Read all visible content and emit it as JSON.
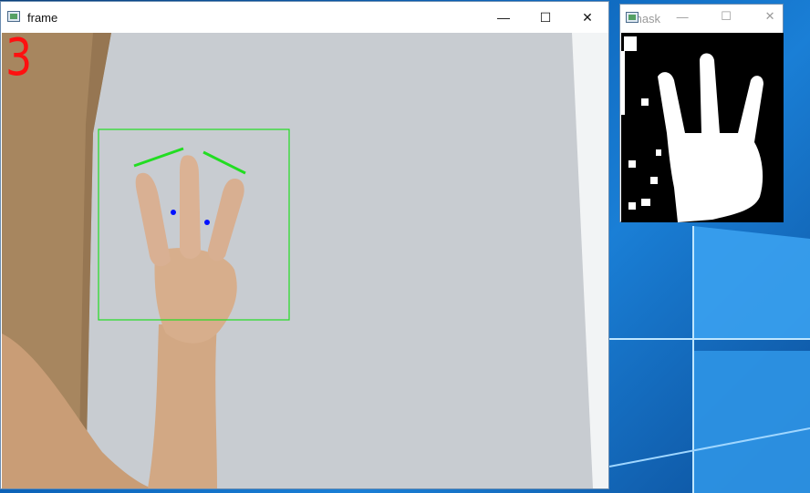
{
  "desktop": {
    "accent": "#0a5fb4"
  },
  "frame_window": {
    "title": "frame",
    "controls": {
      "minimize": "—",
      "maximize": "☐",
      "close": "✕"
    },
    "finger_count": "3"
  },
  "mask_window": {
    "title": "mask",
    "controls": {
      "minimize": "—",
      "maximize": "☐",
      "close": "✕"
    }
  },
  "colors": {
    "bbox": "#22dd22",
    "points": "#0011ff",
    "count": "#ff1010"
  }
}
